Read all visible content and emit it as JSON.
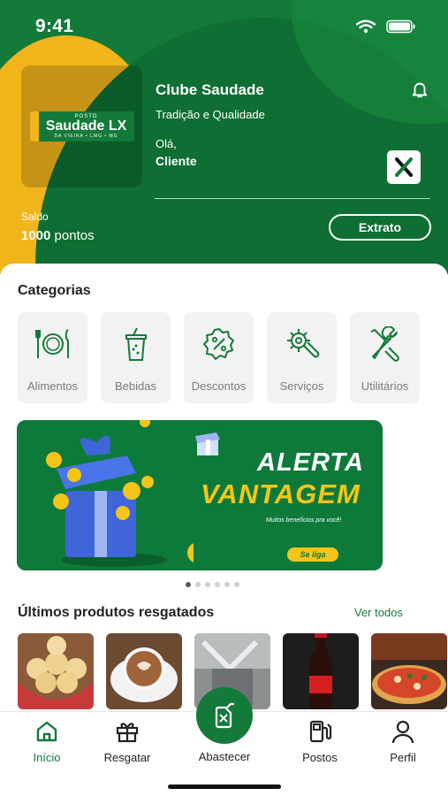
{
  "status_bar": {
    "time": "9:41"
  },
  "club": {
    "logo": {
      "top": "POSTO",
      "name": "Saudade LX",
      "sub": "DA VIEIRA • LMG • MG"
    },
    "title": "Clube Saudade",
    "tagline": "Tradição e Qualidade",
    "greeting": "Olá,",
    "user": "Cliente"
  },
  "balance": {
    "label": "Saldo",
    "value": "1000",
    "unit": "pontos"
  },
  "extrato_label": "Extrato",
  "categories": {
    "title": "Categorias",
    "items": [
      {
        "label": "Alimentos",
        "icon": "plate-cutlery-icon"
      },
      {
        "label": "Bebidas",
        "icon": "cup-icon"
      },
      {
        "label": "Descontos",
        "icon": "percent-badge-icon"
      },
      {
        "label": "Serviços",
        "icon": "gear-wrench-icon"
      },
      {
        "label": "Utilitários",
        "icon": "tools-icon"
      }
    ]
  },
  "banner": {
    "line1": "ALERTA",
    "line2": "VANTAGEM",
    "subtitle": "Muitos benefícios pra você!",
    "cta": "Se liga",
    "pages": 6,
    "active_page": 1
  },
  "recent": {
    "title": "Últimos produtos resgatados",
    "see_all": "Ver todos",
    "items": [
      "cheese-bread",
      "cappuccino",
      "car-wash",
      "coca-cola",
      "pizza"
    ]
  },
  "tabbar": {
    "home": "Início",
    "redeem": "Resgatar",
    "refuel": "Abastecer",
    "stations": "Postos",
    "profile": "Perfil"
  },
  "colors": {
    "brand_green": "#137a3a",
    "brand_yellow": "#f1b51c"
  }
}
